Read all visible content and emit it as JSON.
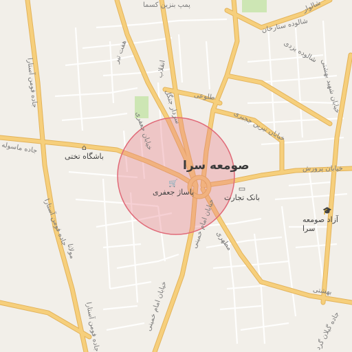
{
  "map": {
    "city_label": "صومعه سرا",
    "accuracy_circle_color": "#e87b86",
    "road_color_major": "#f6cf7c",
    "road_color_minor": "#ffffff",
    "park_color": "#cde6b4",
    "background_color": "#f2efe9",
    "labels": [
      {
        "id": "pump-gas-station",
        "text": "پمپ بنزین کسما"
      },
      {
        "id": "sattarkhan-street",
        "text": "شالوده ستارخان"
      },
      {
        "id": "shalvar-street",
        "text": "شالوار"
      },
      {
        "id": "shalvar-street-2",
        "text": "شالوده یزدی"
      },
      {
        "id": "jade-fooman-astara",
        "text": "جاده فومن آستارا"
      },
      {
        "id": "jade-fooman-astara-2",
        "text": "جاده فومن آستارا"
      },
      {
        "id": "jade-fooman-astara-3",
        "text": "جاده فومن آستارا"
      },
      {
        "id": "haftetir-street",
        "text": "هفت تیر"
      },
      {
        "id": "sardar-jangal-street",
        "text": "سردار جنگل"
      },
      {
        "id": "enghelab-street",
        "text": "انقلاب"
      },
      {
        "id": "jafari-street",
        "text": "خیابان جعفری"
      },
      {
        "id": "talebi-street",
        "text": "طلوعی"
      },
      {
        "id": "imam-street",
        "text": "خیابان امام خمینی"
      },
      {
        "id": "imam-street-2",
        "text": "خیابان امام خمینی"
      },
      {
        "id": "motahari-street",
        "text": "مطهری"
      },
      {
        "id": "beheshti-street",
        "text": "بهشتی"
      },
      {
        "id": "parvaresh-street",
        "text": "خیابان پرورش"
      },
      {
        "id": "sahili-street",
        "text": "خیابان شهید بهشتی"
      },
      {
        "id": "faqih-street",
        "text": "خیابان نیرین ججبری"
      },
      {
        "id": "gilan-street",
        "text": "جاده گیلان گرد"
      },
      {
        "id": "molavi-street",
        "text": "مولانا"
      },
      {
        "id": "jade-maasule",
        "text": "جاده ماسوله"
      }
    ],
    "pois": [
      {
        "id": "bashgah-takhti",
        "text": "باشگاه تختی"
      },
      {
        "id": "pasaj-jafari",
        "text": "پاساژ جعفری"
      },
      {
        "id": "bank-tejarat",
        "text": "بانک تجارت"
      },
      {
        "id": "azad-university",
        "text": "آزاد صومعه سرا"
      }
    ]
  }
}
